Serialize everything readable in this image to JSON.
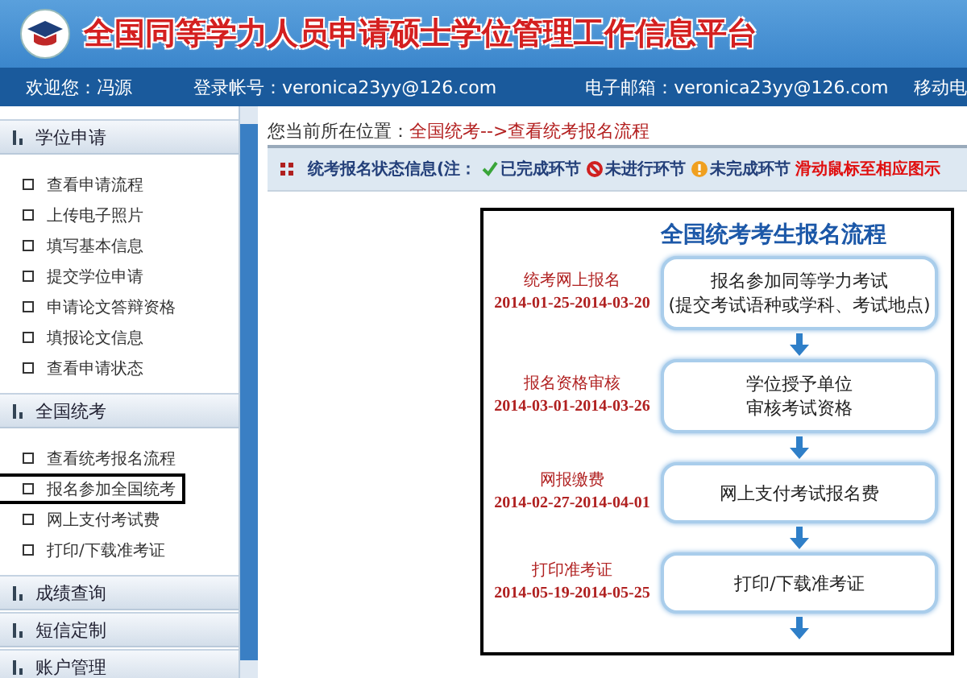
{
  "header": {
    "title": "全国同等学力人员申请硕士学位管理工作信息平台"
  },
  "user_bar": {
    "welcome": "欢迎您：冯源",
    "account": "登录帐号：veronica23yy@126.com",
    "email": "电子邮箱：veronica23yy@126.com",
    "mobile": "移动电"
  },
  "sidebar": {
    "sections": [
      {
        "title": "学位申请",
        "items": [
          {
            "label": "查看申请流程",
            "selected": false
          },
          {
            "label": "上传电子照片",
            "selected": false
          },
          {
            "label": "填写基本信息",
            "selected": false
          },
          {
            "label": "提交学位申请",
            "selected": false
          },
          {
            "label": "申请论文答辩资格",
            "selected": false
          },
          {
            "label": "填报论文信息",
            "selected": false
          },
          {
            "label": "查看申请状态",
            "selected": false
          }
        ]
      },
      {
        "title": "全国统考",
        "items": [
          {
            "label": "查看统考报名流程",
            "selected": false
          },
          {
            "label": "报名参加全国统考",
            "selected": true
          },
          {
            "label": "网上支付考试费",
            "selected": false
          },
          {
            "label": "打印/下载准考证",
            "selected": false
          }
        ]
      },
      {
        "title": "成绩查询"
      },
      {
        "title": "短信定制"
      },
      {
        "title": "账户管理"
      }
    ]
  },
  "breadcrumb": {
    "prefix": "您当前所在位置：",
    "path": "全国统考-->查看统考报名流程"
  },
  "status_legend": {
    "title": "统考报名状态信息(注：",
    "entries": [
      {
        "kind": "done",
        "label": "已完成环节"
      },
      {
        "kind": "not_started",
        "label": "未进行环节"
      },
      {
        "kind": "incomplete",
        "label": "未完成环节"
      }
    ],
    "hint": "滑动鼠标至相应图示"
  },
  "flow": {
    "title": "全国统考考生报名流程",
    "steps": [
      {
        "name": "统考网上报名",
        "dates": "2014-01-25-2014-03-20",
        "lines": [
          "报名参加同等学力考试",
          "(提交考试语种或学科、考试地点)"
        ]
      },
      {
        "name": "报名资格审核",
        "dates": "2014-03-01-2014-03-26",
        "lines": [
          "学位授予单位",
          "审核考试资格"
        ]
      },
      {
        "name": "网报缴费",
        "dates": "2014-02-27-2014-04-01",
        "lines": [
          "网上支付考试报名费"
        ]
      },
      {
        "name": "打印准考证",
        "dates": "2014-05-19-2014-05-25",
        "lines": [
          "打印/下载准考证"
        ]
      }
    ]
  }
}
